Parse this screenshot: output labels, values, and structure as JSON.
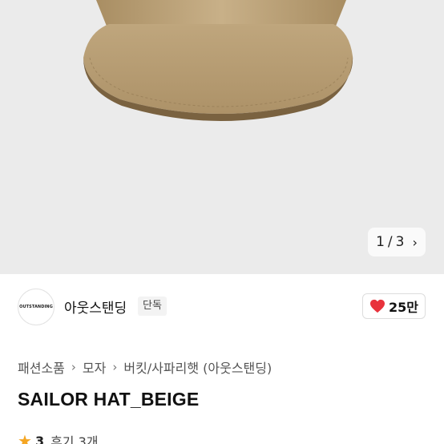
{
  "gallery": {
    "current": "1",
    "separator": "/",
    "total": "3",
    "next_icon": "chevron-right-icon"
  },
  "brand": {
    "logo_text": "OUTSTANDING",
    "name": "아웃스탠딩",
    "badge": "단독"
  },
  "like": {
    "icon": "heart-icon",
    "count": "25만",
    "color": "#e8323c"
  },
  "breadcrumb": {
    "items": [
      "패션소품",
      "모자",
      "버킷/사파리햇 (아웃스탠딩)"
    ]
  },
  "product": {
    "title": "SAILOR HAT_BEIGE"
  },
  "rating": {
    "score": "3",
    "reviews": "후기 3개",
    "star_color": "#f5a623"
  }
}
